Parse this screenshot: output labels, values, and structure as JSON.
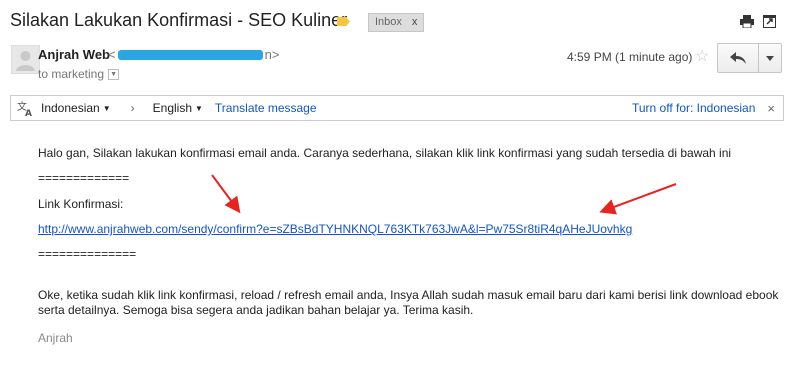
{
  "subject": "Silakan Lakukan Konfirmasi - SEO Kuliner",
  "label_chip": {
    "text": "Inbox",
    "close": "x"
  },
  "colors": {
    "label_tag": "#f5c542",
    "link": "#1155cc",
    "arrow": "#e8241f",
    "redaction": "#2aa7e0"
  },
  "toolbar_icons": [
    "print-icon",
    "new-window-icon"
  ],
  "sender": {
    "name": "Anjrah Web",
    "email_prefix": "<",
    "email_suffix": "n>",
    "to_line": "to marketing",
    "time": "4:59 PM (1 minute ago)"
  },
  "translate_bar": {
    "source_lang": "Indonesian",
    "separator": "›",
    "target_lang": "English",
    "translate_link": "Translate message",
    "turn_off": "Turn off for: Indonesian",
    "close": "×"
  },
  "body": {
    "greeting": "Halo gan, Silakan lakukan konfirmasi email anda. Caranya sederhana, silakan klik link konfirmasi yang sudah tersedia di bawah ini",
    "divider_top": "=============",
    "link_label": "Link Konfirmasi:",
    "confirm_url": "http://www.anjrahweb.com/sendy/confirm?e=sZBsBdTYHNKNQL763KTk763JwA&l=Pw75Sr8tiR4qAHeJUovhkg",
    "divider_bottom": "==============",
    "closing_line1": "Oke, ketika sudah klik link konfirmasi, reload / refresh email anda, Insya Allah sudah masuk email baru dari kami berisi link download ebook",
    "closing_line2": "serta detailnya. Semoga bisa segera anda jadikan bahan belajar ya. Terima kasih.",
    "signature": "Anjrah"
  }
}
